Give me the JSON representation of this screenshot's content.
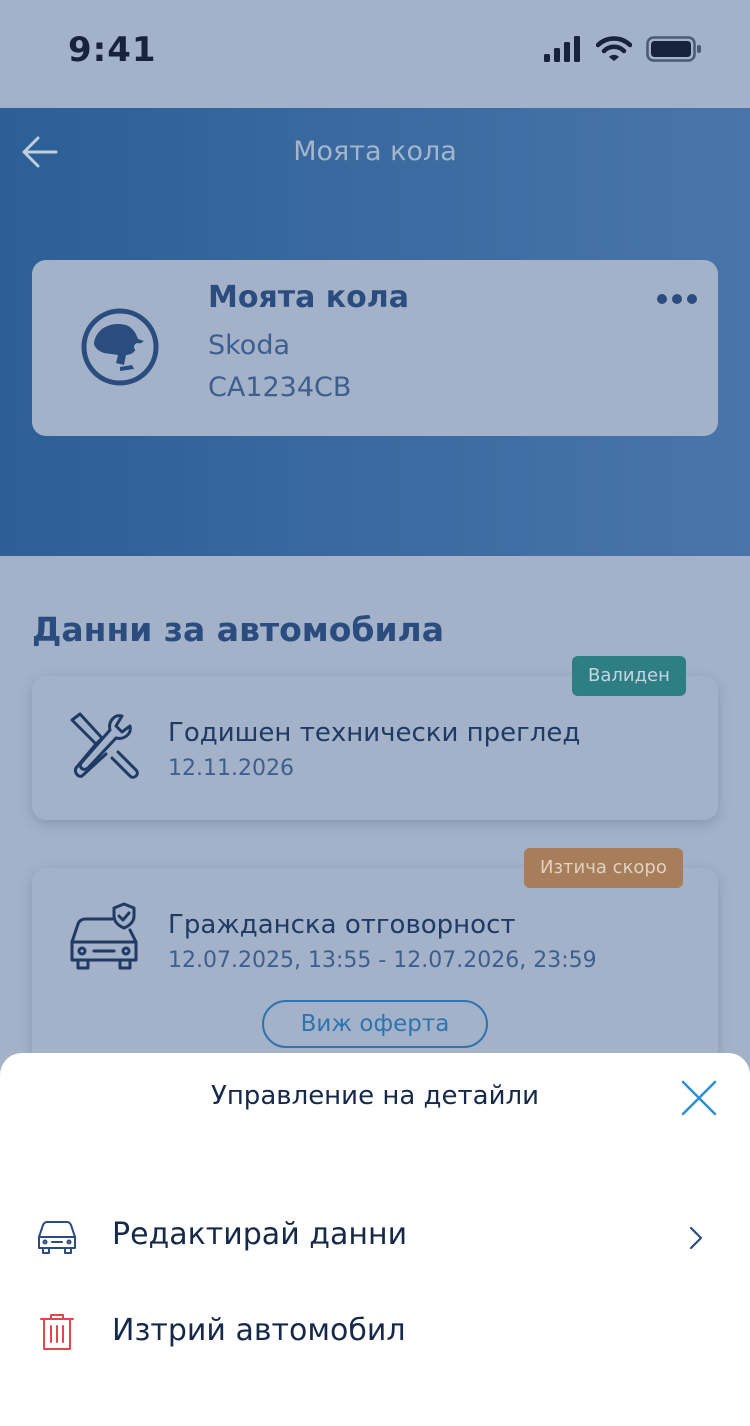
{
  "status_bar": {
    "time": "9:41"
  },
  "header": {
    "title": "Моята кола"
  },
  "car": {
    "name": "Моята кола",
    "make": "Skoda",
    "plate": "CA1234CB"
  },
  "section": {
    "title": "Данни за автомобила"
  },
  "cards": [
    {
      "title": "Годишен технически преглед",
      "subtitle": "12.11.2026",
      "badge": "Валиден",
      "badge_color": "#2d7f84"
    },
    {
      "title": "Гражданска отговорност",
      "subtitle": "12.07.2025, 13:55 - 12.07.2026, 23:59",
      "badge": "Изтича скоро",
      "badge_color": "#a87d5a",
      "button": "Виж оферта"
    }
  ],
  "sheet": {
    "title": "Управление на детайли",
    "items": [
      {
        "label": "Редактирай данни",
        "icon": "car-icon"
      },
      {
        "label": "Изтрий автомобил",
        "icon": "trash-icon"
      }
    ]
  },
  "colors": {
    "header_gradient_start": "#2b5f96",
    "header_gradient_end": "#4a75aa",
    "accent": "#2d74b0",
    "danger": "#e0474c"
  }
}
